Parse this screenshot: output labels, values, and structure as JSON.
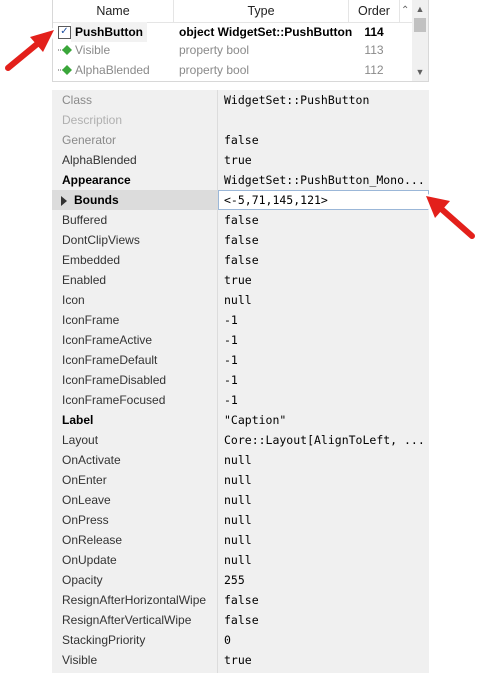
{
  "members": {
    "columns": {
      "name": "Name",
      "type": "Type",
      "order": "Order"
    },
    "rows": [
      {
        "name": "PushButton",
        "type": "object WidgetSet::PushButton",
        "order": "114"
      },
      {
        "name": "Visible",
        "type": "property bool",
        "order": "113"
      },
      {
        "name": "AlphaBlended",
        "type": "property bool",
        "order": "112"
      }
    ]
  },
  "properties": [
    {
      "name": "Class",
      "value": "WidgetSet::PushButton"
    },
    {
      "name": "Description",
      "value": ""
    },
    {
      "name": "Generator",
      "value": "false"
    },
    {
      "name": "AlphaBlended",
      "value": "true"
    },
    {
      "name": "Appearance",
      "value": "WidgetSet::PushButton_Mono..."
    },
    {
      "name": "Bounds",
      "value": "<-5,71,145,121>"
    },
    {
      "name": "Buffered",
      "value": "false"
    },
    {
      "name": "DontClipViews",
      "value": "false"
    },
    {
      "name": "Embedded",
      "value": "false"
    },
    {
      "name": "Enabled",
      "value": "true"
    },
    {
      "name": "Icon",
      "value": "null"
    },
    {
      "name": "IconFrame",
      "value": "-1"
    },
    {
      "name": "IconFrameActive",
      "value": "-1"
    },
    {
      "name": "IconFrameDefault",
      "value": "-1"
    },
    {
      "name": "IconFrameDisabled",
      "value": "-1"
    },
    {
      "name": "IconFrameFocused",
      "value": "-1"
    },
    {
      "name": "Label",
      "value": "\"Caption\""
    },
    {
      "name": "Layout",
      "value": "Core::Layout[AlignToLeft, ..."
    },
    {
      "name": "OnActivate",
      "value": "null"
    },
    {
      "name": "OnEnter",
      "value": "null"
    },
    {
      "name": "OnLeave",
      "value": "null"
    },
    {
      "name": "OnPress",
      "value": "null"
    },
    {
      "name": "OnRelease",
      "value": "null"
    },
    {
      "name": "OnUpdate",
      "value": "null"
    },
    {
      "name": "Opacity",
      "value": "255"
    },
    {
      "name": "ResignAfterHorizontalWipe",
      "value": "false"
    },
    {
      "name": "ResignAfterVerticalWipe",
      "value": "false"
    },
    {
      "name": "StackingPriority",
      "value": "0"
    },
    {
      "name": "Visible",
      "value": "true"
    }
  ],
  "icons": {
    "checked": "checkbox-checked-icon",
    "property": "property-diamond-icon",
    "expand": "expand-triangle-icon",
    "arrow": "red-arrow-icon"
  },
  "colors": {
    "arrow": "#e3201b",
    "diamond": "#3aa63a",
    "grid_bg": "#f0f0f0"
  }
}
